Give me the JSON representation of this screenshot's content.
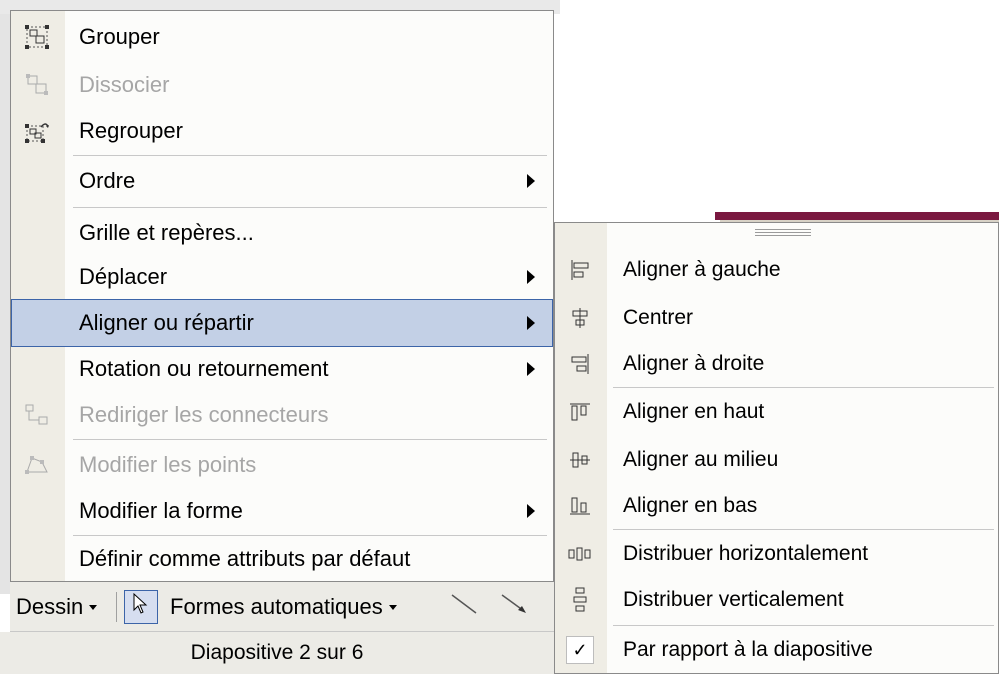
{
  "menu": {
    "items": [
      {
        "label": "Grouper",
        "icon": "group-icon",
        "disabled": false,
        "submenu": false
      },
      {
        "label": "Dissocier",
        "icon": "ungroup-icon",
        "disabled": true,
        "submenu": false
      },
      {
        "label": "Regrouper",
        "icon": "regroup-icon",
        "disabled": false,
        "submenu": false
      },
      {
        "label": "Ordre",
        "icon": "",
        "disabled": false,
        "submenu": true
      },
      {
        "label": "Grille et repères...",
        "icon": "",
        "disabled": false,
        "submenu": false
      },
      {
        "label": "Déplacer",
        "icon": "",
        "disabled": false,
        "submenu": true
      },
      {
        "label": "Aligner ou répartir",
        "icon": "",
        "disabled": false,
        "submenu": true,
        "highlighted": true
      },
      {
        "label": "Rotation ou retournement",
        "icon": "",
        "disabled": false,
        "submenu": true
      },
      {
        "label": "Rediriger les connecteurs",
        "icon": "reroute-connectors-icon",
        "disabled": true,
        "submenu": false
      },
      {
        "label": "Modifier les points",
        "icon": "edit-points-icon",
        "disabled": true,
        "submenu": false
      },
      {
        "label": "Modifier la forme",
        "icon": "",
        "disabled": false,
        "submenu": true
      },
      {
        "label": "Définir comme attributs par défaut",
        "icon": "",
        "disabled": false,
        "submenu": false
      }
    ]
  },
  "submenu": {
    "items": [
      {
        "label": "Aligner à gauche",
        "icon": "align-left-icon"
      },
      {
        "label": "Centrer",
        "icon": "align-center-icon"
      },
      {
        "label": "Aligner à droite",
        "icon": "align-right-icon"
      },
      {
        "label": "Aligner en haut",
        "icon": "align-top-icon"
      },
      {
        "label": "Aligner au milieu",
        "icon": "align-middle-icon"
      },
      {
        "label": "Aligner en bas",
        "icon": "align-bottom-icon"
      },
      {
        "label": "Distribuer horizontalement",
        "icon": "distribute-horizontal-icon"
      },
      {
        "label": "Distribuer verticalement",
        "icon": "distribute-vertical-icon"
      },
      {
        "label": "Par rapport à la diapositive",
        "icon": "checkmark-icon",
        "checked": true
      }
    ]
  },
  "toolbar": {
    "draw_label": "Dessin",
    "autoshapes_label": "Formes automatiques"
  },
  "status": {
    "slide_text": "Diapositive 2 sur 6"
  },
  "colors": {
    "highlight": "#c3d0e6",
    "highlight_border": "#3c64a8",
    "disabled_text": "#a6a6a6",
    "gutter": "#efede5"
  }
}
